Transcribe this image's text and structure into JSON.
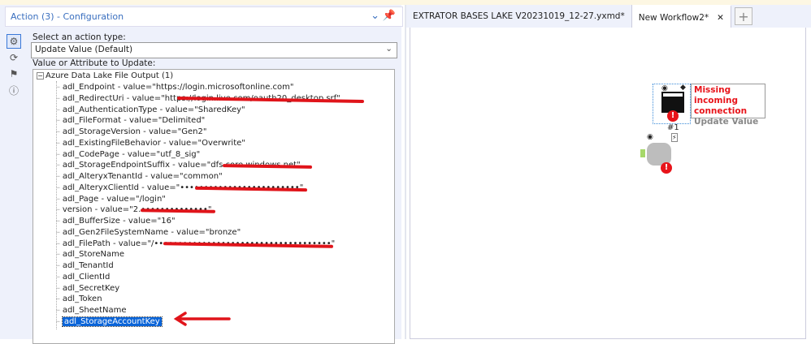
{
  "panel": {
    "title": "Action (3) - Configuration",
    "select_label": "Select an action type:",
    "action_type": "Update Value (Default)",
    "tree_label": "Value or Attribute to Update:"
  },
  "tree": {
    "root": "Azure Data Lake File Output (1)",
    "items": [
      {
        "text": "adl_Endpoint - value=\"https://login.microsoftonline.com\"",
        "redacted": false
      },
      {
        "text": "adl_RedirectUri - value=\"https://login.live.com/oauth20_desktop.srf\"",
        "redacted": true
      },
      {
        "text": "adl_AuthenticationType - value=\"SharedKey\"",
        "redacted": false
      },
      {
        "text": "adl_FileFormat - value=\"Delimited\"",
        "redacted": false
      },
      {
        "text": "adl_StorageVersion - value=\"Gen2\"",
        "redacted": false
      },
      {
        "text": "adl_ExistingFileBehavior - value=\"Overwrite\"",
        "redacted": false
      },
      {
        "text": "adl_CodePage - value=\"utf_8_sig\"",
        "redacted": false
      },
      {
        "text": "adl_StorageEndpointSuffix - value=\"dfs.core.windows.net\"",
        "redacted": true
      },
      {
        "text": "adl_AlteryxTenantId - value=\"common\"",
        "redacted": false
      },
      {
        "text": "adl_AlteryxClientId - value=\"•••••••••••••••••••••••••\"",
        "redacted": true
      },
      {
        "text": "adl_Page - value=\"/login\"",
        "redacted": false
      },
      {
        "text": "version - value=\"2.••••••••••••••\"",
        "redacted": true
      },
      {
        "text": "adl_BufferSize - value=\"16\"",
        "redacted": false
      },
      {
        "text": "adl_Gen2FileSystemName - value=\"bronze\"",
        "redacted": false
      },
      {
        "text": "adl_FilePath - value=\"/•••••••••••••••••••••••••••••••••••••\"",
        "redacted": true
      },
      {
        "text": "adl_StoreName",
        "redacted": false
      },
      {
        "text": "adl_TenantId",
        "redacted": false
      },
      {
        "text": "adl_ClientId",
        "redacted": false
      },
      {
        "text": "adl_SecretKey",
        "redacted": false
      },
      {
        "text": "adl_Token",
        "redacted": false
      },
      {
        "text": "adl_SheetName",
        "redacted": false
      },
      {
        "text": "adl_StorageAccountKey",
        "redacted": false,
        "selected": true
      }
    ]
  },
  "tabs": [
    {
      "label": "EXTRATOR BASES LAKE V20231019_12-27.yxmd*",
      "active": false
    },
    {
      "label": "New Workflow2*",
      "active": true
    }
  ],
  "canvas": {
    "tool_id": "#1",
    "error_title": "Missing incoming connection",
    "tool_annotation": "Update Value"
  },
  "colors": {
    "accent": "#3a6fbf",
    "error": "#e8141a",
    "selection": "#0a64d8"
  }
}
